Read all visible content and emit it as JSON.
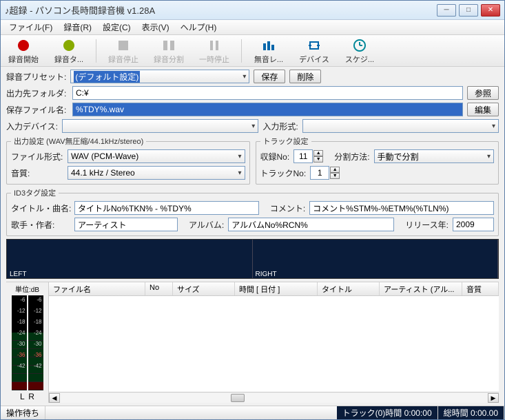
{
  "window": {
    "title": "♪超録 - パソコン長時間録音機 v1.28A"
  },
  "menu": {
    "file": "ファイル(F)",
    "record": "録音(R)",
    "settings": "設定(C)",
    "view": "表示(V)",
    "help": "ヘルプ(H)"
  },
  "toolbar": {
    "rec_label": "録音開始",
    "rectimer_label": "録音タ...",
    "recstop_label": "録音停止",
    "split_label": "録音分割",
    "pause_label": "一時停止",
    "silence_label": "無音レ...",
    "device_label": "デバイス",
    "schedule_label": "スケジ..."
  },
  "preset": {
    "label": "録音プリセット:",
    "value": "(デフォルト設定)",
    "save": "保存",
    "delete": "削除"
  },
  "output": {
    "folder_label": "出力先フォルダ:",
    "folder_value": "C:¥",
    "browse": "参照",
    "filename_label": "保存ファイル名:",
    "filename_value": "%TDY%.wav",
    "edit": "編集"
  },
  "device": {
    "input_label": "入力デバイス:",
    "input_value": "",
    "format_label": "入力形式:",
    "format_value": ""
  },
  "outcfg": {
    "legend": "出力設定 (WAV無圧縮/44.1kHz/stereo)",
    "ftype_label": "ファイル形式:",
    "ftype_value": "WAV (PCM-Wave)",
    "quality_label": "音質:",
    "quality_value": "44.1 kHz / Stereo"
  },
  "track": {
    "legend": "トラック設定",
    "recno_label": "収録No:",
    "recno_value": "11",
    "split_label": "分割方法:",
    "split_value": "手動で分割",
    "trackno_label": "トラックNo:",
    "trackno_value": "1"
  },
  "id3": {
    "legend": "ID3タグ設定",
    "title_label": "タイトル・曲名:",
    "title_value": "タイトルNo%TKN% - %TDY%",
    "comment_label": "コメント:",
    "comment_value": "コメント%STM%-%ETM%(%TLN%)",
    "artist_label": "歌手・作者:",
    "artist_value": "アーティスト",
    "album_label": "アルバム:",
    "album_value": "アルバムNo%RCN%",
    "year_label": "リリース年:",
    "year_value": "2009"
  },
  "wave": {
    "left": "LEFT",
    "right": "RIGHT"
  },
  "meter": {
    "header": "単位:dB",
    "l": "L",
    "r": "R",
    "ticks": [
      "-6",
      "-12",
      "-18",
      "-24",
      "-30",
      "-36",
      "-42"
    ]
  },
  "filelist": {
    "cols": {
      "name": "ファイル名",
      "no": "No",
      "size": "サイズ",
      "time": "時間 [ 日付 ]",
      "title": "タイトル",
      "artist": "アーティスト (アル...",
      "quality": "音質"
    }
  },
  "status": {
    "idle": "操作待ち",
    "track": "トラック(0)時間 0:00:00",
    "total": "総時間 0:00.00"
  }
}
